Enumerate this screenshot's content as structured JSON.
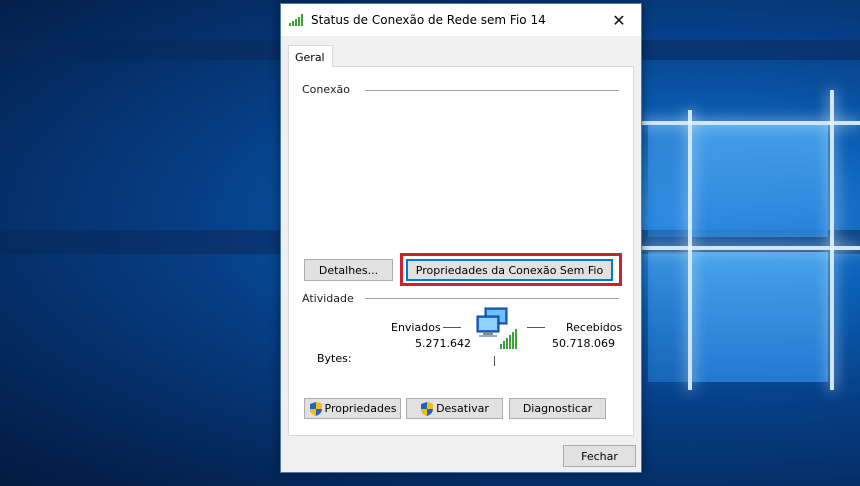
{
  "window": {
    "title": "Status de Conexão de Rede sem Fio 14",
    "close_glyph": "✕"
  },
  "tabs": [
    {
      "label": "Geral",
      "selected": true
    }
  ],
  "connection": {
    "group_label": "Conexão",
    "details_button": "Detalhes...",
    "wireless_properties_button": "Propriedades da Conexão Sem Fio"
  },
  "activity": {
    "group_label": "Atividade",
    "sent_label": "Enviados",
    "received_label": "Recebidos",
    "bytes_label": "Bytes:",
    "bytes_sent": "5.271.642",
    "bytes_received": "50.718.069"
  },
  "actions": {
    "properties_button": "Propriedades",
    "disable_button": "Desativar",
    "diagnose_button": "Diagnosticar"
  },
  "footer": {
    "close_button": "Fechar"
  },
  "icons": {
    "title": "wifi-signal-icon",
    "network_activity": "network-computers-icon",
    "admin_shield": "uac-shield-icon"
  },
  "colors": {
    "highlight": "#d0202e",
    "focus_border": "#0078d7",
    "signal_green": "#3aa33a"
  }
}
